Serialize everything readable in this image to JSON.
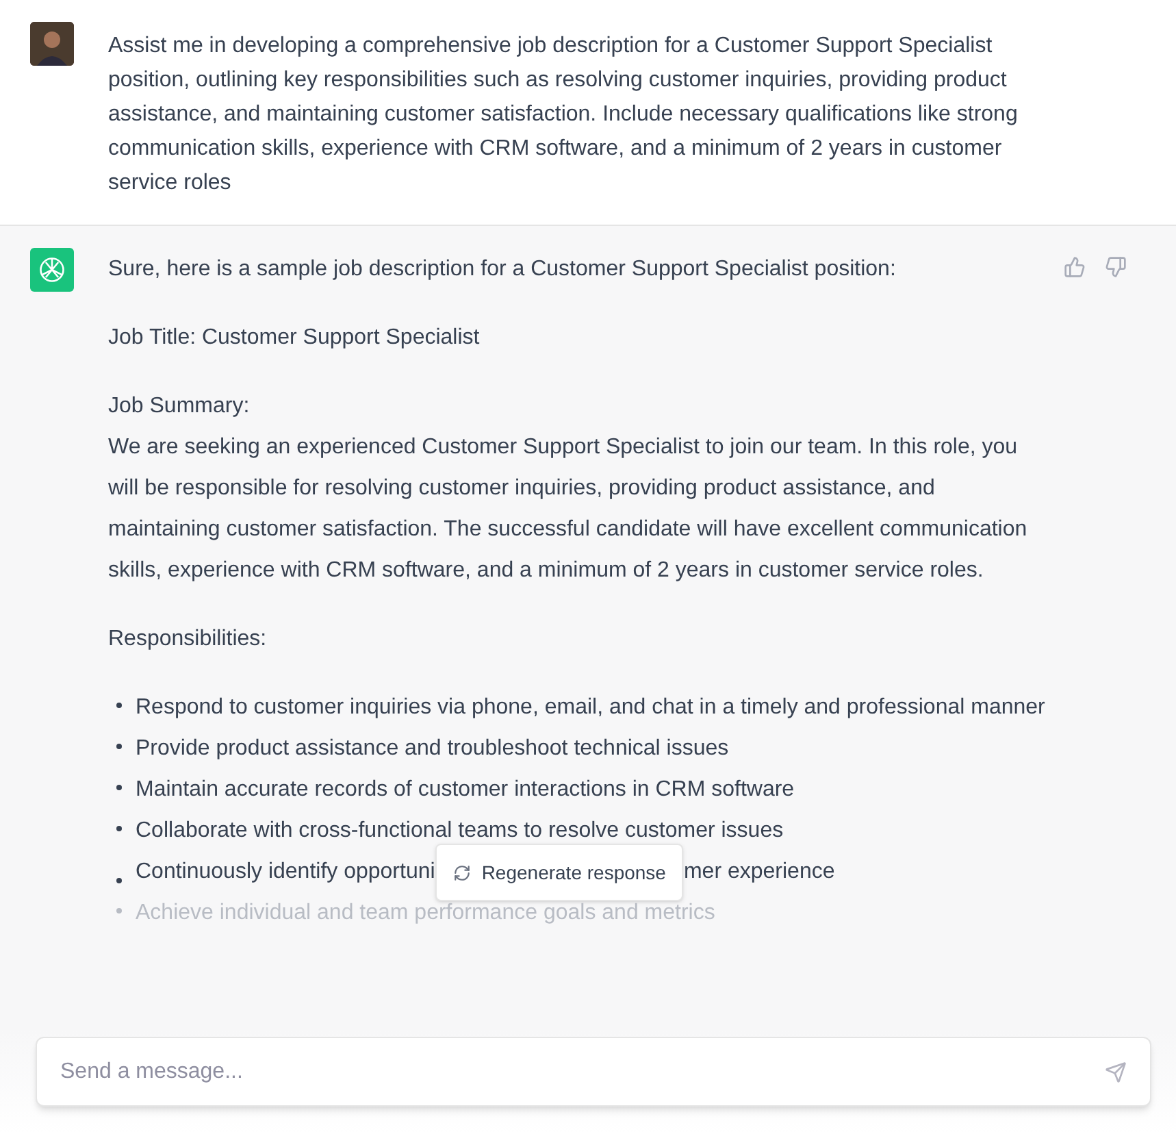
{
  "user_message": {
    "text": "Assist me in developing a comprehensive job description for a Customer Support Specialist position, outlining key responsibilities such as resolving customer inquiries, providing product assistance, and maintaining customer satisfaction. Include necessary qualifications like strong communication skills, experience with CRM software, and a minimum of 2 years in customer service roles"
  },
  "assistant_message": {
    "intro": "Sure, here is a sample job description for a Customer Support Specialist position:",
    "job_title": "Job Title: Customer Support Specialist",
    "summary_heading": "Job Summary:",
    "summary": "We are seeking an experienced Customer Support Specialist to join our team. In this role, you will be responsible for resolving customer inquiries, providing product assistance, and maintaining customer satisfaction. The successful candidate will have excellent communication skills, experience with CRM software, and a minimum of 2 years in customer service roles.",
    "responsibilities_heading": "Responsibilities:",
    "responsibilities": [
      {
        "kind": "plain",
        "text": "Respond to customer inquiries via phone, email, and chat in a timely and professional manner"
      },
      {
        "kind": "plain",
        "text": "Provide product assistance and troubleshoot technical issues"
      },
      {
        "kind": "plain",
        "text": "Maintain accurate records of customer interactions in CRM software"
      },
      {
        "kind": "plain",
        "text": "Collaborate with cross-functional teams to resolve customer issues"
      },
      {
        "kind": "covered",
        "text_before": "Continuously identify opportuni",
        "text_after": "mer experience"
      },
      {
        "kind": "faded",
        "text": "Achieve individual and team performance goals and metrics"
      }
    ]
  },
  "regenerate_button": {
    "label": "Regenerate response"
  },
  "composer": {
    "placeholder": "Send a message..."
  }
}
